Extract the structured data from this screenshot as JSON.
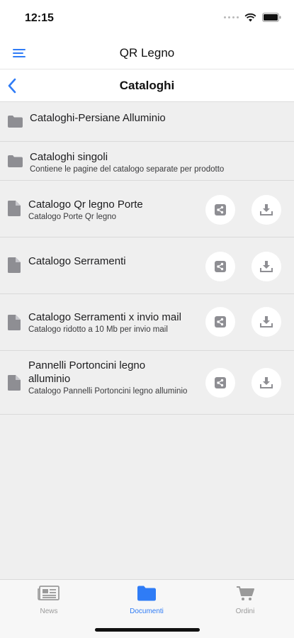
{
  "status": {
    "time": "12:15"
  },
  "header": {
    "title": "QR Legno"
  },
  "nav": {
    "title": "Cataloghi"
  },
  "items": [
    {
      "type": "folder",
      "title": "Cataloghi-Persiane Alluminio",
      "subtitle": "",
      "actions": false
    },
    {
      "type": "folder",
      "title": "Cataloghi singoli",
      "subtitle": "Contiene le pagine del catalogo separate per prodotto",
      "actions": false
    },
    {
      "type": "file",
      "title": "Catalogo Qr legno Porte",
      "subtitle": "Catalogo Porte Qr legno",
      "actions": true
    },
    {
      "type": "file",
      "title": "Catalogo Serramenti",
      "subtitle": "",
      "actions": true
    },
    {
      "type": "file",
      "title": "Catalogo Serramenti x invio mail",
      "subtitle": "Catalogo ridotto a 10 Mb per invio mail",
      "actions": true
    },
    {
      "type": "file",
      "title": "Pannelli Portoncini legno alluminio",
      "subtitle": "Catalogo Pannelli Portoncini legno alluminio",
      "actions": true
    }
  ],
  "tabs": [
    {
      "label": "News",
      "icon": "newspaper-icon",
      "active": false
    },
    {
      "label": "Documenti",
      "icon": "folder-icon",
      "active": true
    },
    {
      "label": "Ordini",
      "icon": "cart-icon",
      "active": false
    }
  ],
  "colors": {
    "accent": "#2f7cf6",
    "icon_gray": "#8e8e93",
    "inactive": "#9a9a9a"
  }
}
